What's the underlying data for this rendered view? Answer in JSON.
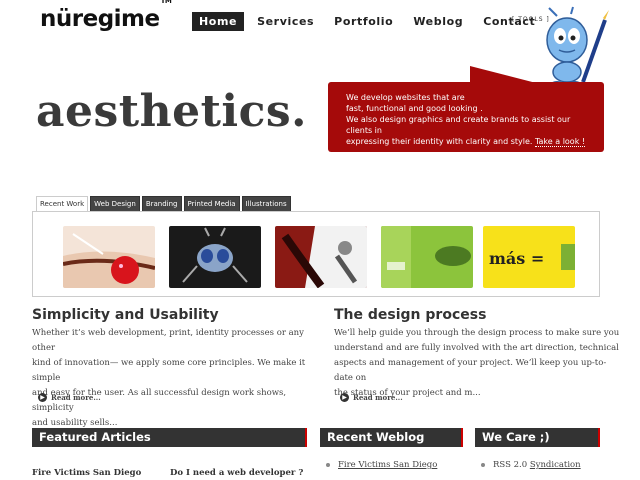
{
  "header": {
    "logo": "nüregime",
    "trademark": "TM",
    "nav": [
      "Home",
      "Services",
      "Portfolio",
      "Weblog",
      "Contact"
    ],
    "tools": "[ TOOLS ]"
  },
  "hero": {
    "word": "aesthetics.",
    "bubble": {
      "line1": "We develop websites that are",
      "line2": "fast,  functional and good looking .",
      "line3": "We also design graphics and create brands to assist our clients in",
      "line4": "expressing their identity with clarity and style.",
      "link": "Take a look !"
    }
  },
  "tabs": [
    "Recent Work",
    "Web Design",
    "Branding",
    "Printed Media",
    "Illustrations"
  ],
  "gallery": {
    "thumb5_text": "más ="
  },
  "sections": {
    "left": {
      "title": "Simplicity and Usability",
      "line1": "Whether it’s web development, print, identity processes or any other",
      "line2": "kind of innovation— we apply some core  principles. We make it simple",
      "line3": "and easy for the user. As all successful design work shows, simplicity",
      "line4": "and usability sells...",
      "more": "Read more..."
    },
    "right": {
      "title": "The design process",
      "line1": "We’ll help guide you through the design process to make sure you",
      "line2": "understand and are fully involved with the art direction, technical",
      "line3": "aspects and management of your project. We’ll keep you up-to-date on",
      "line4": "the status of your project and m...",
      "more": "Read more..."
    }
  },
  "bottom": {
    "featured_title": "Featured Articles",
    "weblog_title": "Recent Weblog Entries",
    "care_title": "We Care ;)",
    "articles": [
      "Fire Victims San Diego",
      "Do I need a web developer ?"
    ],
    "weblog_entry": "Fire Victims San Diego",
    "care_prefix": "RSS 2.0",
    "care_link": "Syndication"
  },
  "colors": {
    "accent": "#a50a0a",
    "dark": "#333333"
  }
}
